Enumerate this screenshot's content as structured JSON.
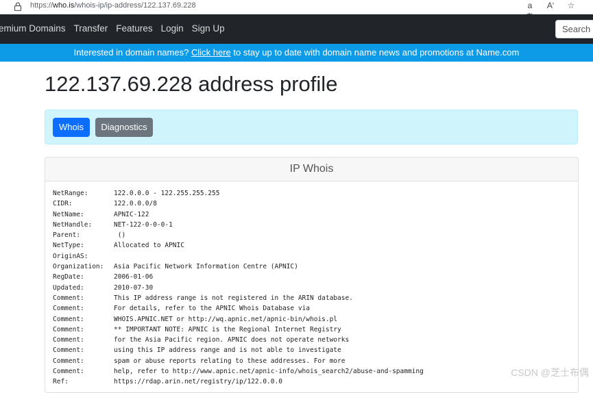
{
  "browser": {
    "url_prefix": "https://",
    "url_host": "who.is",
    "url_path": "/whois-ip/ip-address/122.137.69.228",
    "read_aloud": "aあ",
    "text_size": "Aʹ",
    "favorite": "☆"
  },
  "nav": {
    "items": [
      "emium Domains",
      "Transfer",
      "Features",
      "Login",
      "Sign Up"
    ],
    "search_placeholder": "Search d"
  },
  "promo": {
    "before": "Interested in domain names? ",
    "link": "Click here",
    "after": " to stay up to date with domain name news and promotions at Name.com"
  },
  "page": {
    "title": "122.137.69.228 address profile",
    "tabs": {
      "whois": "Whois",
      "diagnostics": "Diagnostics"
    }
  },
  "card": {
    "header": "IP Whois",
    "rows": [
      {
        "key": "NetRange:",
        "value": "122.0.0.0 - 122.255.255.255"
      },
      {
        "key": "CIDR:",
        "value": "122.0.0.0/8"
      },
      {
        "key": "NetName:",
        "value": "APNIC-122"
      },
      {
        "key": "NetHandle:",
        "value": "NET-122-0-0-0-1"
      },
      {
        "key": "Parent:",
        "value": " ()"
      },
      {
        "key": "NetType:",
        "value": "Allocated to APNIC"
      },
      {
        "key": "OriginAS:",
        "value": ""
      },
      {
        "key": "Organization:",
        "value": "Asia Pacific Network Information Centre (APNIC)"
      },
      {
        "key": "RegDate:",
        "value": "2006-01-06"
      },
      {
        "key": "Updated:",
        "value": "2010-07-30"
      },
      {
        "key": "Comment:",
        "value": "This IP address range is not registered in the ARIN database."
      },
      {
        "key": "Comment:",
        "value": "For details, refer to the APNIC Whois Database via"
      },
      {
        "key": "Comment:",
        "value": "WHOIS.APNIC.NET or http://wq.apnic.net/apnic-bin/whois.pl"
      },
      {
        "key": "Comment:",
        "value": "** IMPORTANT NOTE: APNIC is the Regional Internet Registry"
      },
      {
        "key": "Comment:",
        "value": "for the Asia Pacific region. APNIC does not operate networks"
      },
      {
        "key": "Comment:",
        "value": "using this IP address range and is not able to investigate"
      },
      {
        "key": "Comment:",
        "value": "spam or abuse reports relating to these addresses. For more"
      },
      {
        "key": "Comment:",
        "value": "help, refer to http://www.apnic.net/apnic-info/whois_search2/abuse-and-spamming"
      },
      {
        "key": "Ref:",
        "value": "https://rdap.arin.net/registry/ip/122.0.0.0"
      }
    ]
  },
  "watermark": "CSDN @芝士布偶"
}
